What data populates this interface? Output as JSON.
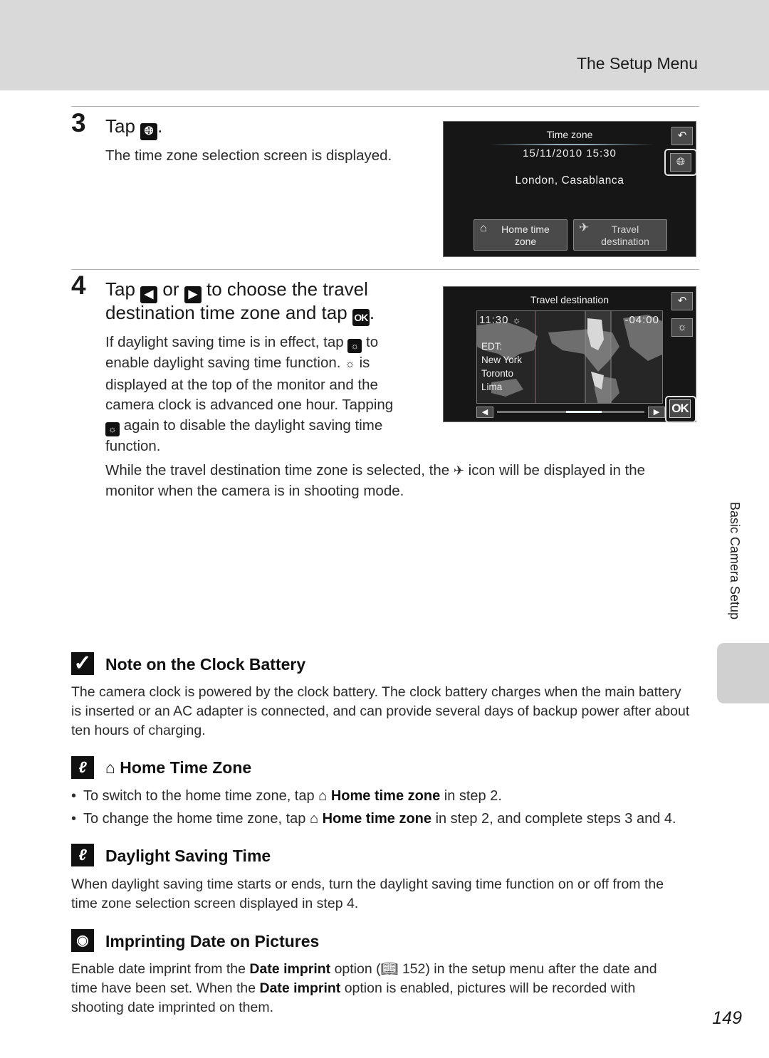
{
  "header": {
    "section_title": "The Setup Menu"
  },
  "step3": {
    "number": "3",
    "heading_prefix": "Tap",
    "heading_icon": "globe-icon",
    "heading_suffix": ".",
    "description": "The time zone selection screen is displayed."
  },
  "screen1": {
    "title": "Time zone",
    "datetime": "15/11/2010  15:30",
    "location": "London, Casablanca",
    "back_icon": "back-arrow-icon",
    "globe_icon": "globe-icon",
    "home_button": {
      "icon": "home-icon",
      "label_line1": "Home time",
      "label_line2": "zone"
    },
    "travel_button": {
      "icon": "airplane-icon",
      "label_line1": "Travel",
      "label_line2": "destination"
    }
  },
  "step4": {
    "number": "4",
    "heading_part1": "Tap",
    "heading_or": "or",
    "heading_part2": "to choose the travel",
    "heading_line2": "destination time zone and tap",
    "heading_end": ".",
    "ok_glyph": "OK",
    "para_lines": [
      "If daylight saving time is in effect, tap",
      "to",
      "enable daylight saving time function.",
      "is",
      "displayed at the top of the monitor and the",
      "camera clock is advanced one hour. Tapping",
      "again to disable the daylight saving time",
      "function."
    ],
    "travel_note_line1_a": "While the travel destination time zone is selected, the",
    "travel_note_line1_b": "icon will be displayed in the",
    "travel_note_line2": "monitor when the camera is in shooting mode."
  },
  "screen2": {
    "title": "Travel destination",
    "local_time": "11:30",
    "offset": "-04:00",
    "dst_label": "EDT:",
    "cities": [
      "New York",
      "Toronto",
      "Lima"
    ],
    "ok_label": "OK",
    "back_icon": "back-arrow-icon",
    "dst_icon": "daylight-saving-icon",
    "left_icon": "left-arrow-icon",
    "right_icon": "right-arrow-icon",
    "slider_position": 0.62
  },
  "sidebar": {
    "chapter_label": "Basic Camera Setup"
  },
  "notes": {
    "clock_battery": {
      "title": "Note on the Clock Battery",
      "lines": [
        "The camera clock is powered by the clock battery. The clock battery charges when the main battery",
        "is inserted or an AC adapter is connected, and can provide several days of backup power after about",
        "ten hours of charging."
      ]
    },
    "home_time_zone": {
      "title": "Home Time Zone",
      "bullet1_a": "To switch to the home time zone, tap",
      "bullet1_bold": "Home time zone",
      "bullet1_b": "in step 2.",
      "bullet2_a": "To change the home time zone, tap",
      "bullet2_bold": "Home time zone",
      "bullet2_b": "in step 2, and complete steps 3 and 4."
    },
    "daylight_saving": {
      "title": "Daylight Saving Time",
      "lines": [
        "When daylight saving time starts or ends, turn the daylight saving time function on or off from the",
        "time zone selection screen displayed in step 4."
      ]
    },
    "imprint": {
      "title": "Imprinting Date on Pictures",
      "line1_a": "Enable date imprint from the",
      "line1_bold": "Date imprint",
      "line1_b": "option (",
      "line1_ref": "152) in the setup menu after the date and",
      "line2_a": "time have been set. When the",
      "line2_bold": "Date imprint",
      "line2_b": "option is enabled, pictures will be recorded with",
      "line3": "shooting date imprinted on them."
    }
  },
  "page_number": "149"
}
